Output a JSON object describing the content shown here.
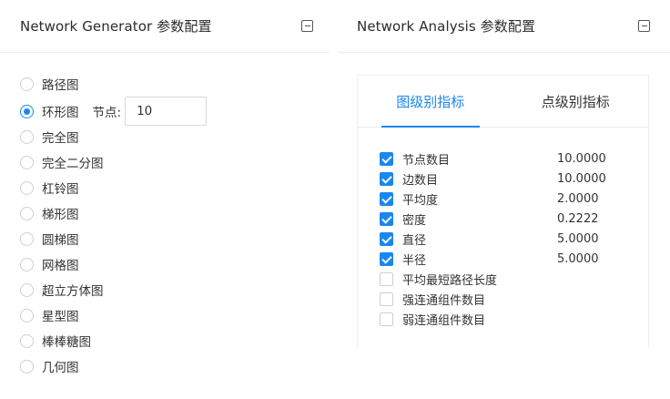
{
  "generator": {
    "title": "Network Generator 参数配置",
    "options": [
      {
        "label": "路径图",
        "checked": false
      },
      {
        "label": "环形图",
        "checked": true
      },
      {
        "label": "完全图",
        "checked": false
      },
      {
        "label": "完全二分图",
        "checked": false
      },
      {
        "label": "杠铃图",
        "checked": false
      },
      {
        "label": "梯形图",
        "checked": false
      },
      {
        "label": "圆梯图",
        "checked": false
      },
      {
        "label": "网格图",
        "checked": false
      },
      {
        "label": "超立方体图",
        "checked": false
      },
      {
        "label": "星型图",
        "checked": false
      },
      {
        "label": "棒棒糖图",
        "checked": false
      },
      {
        "label": "几何图",
        "checked": false
      }
    ],
    "node_label": "节点:",
    "node_value": "10"
  },
  "analysis": {
    "title": "Network Analysis 参数配置",
    "tabs": [
      {
        "label": "图级别指标",
        "active": true
      },
      {
        "label": "点级别指标",
        "active": false
      }
    ],
    "metrics": [
      {
        "name": "节点数目",
        "value": "10.0000",
        "checked": true
      },
      {
        "name": "边数目",
        "value": "10.0000",
        "checked": true
      },
      {
        "name": "平均度",
        "value": "2.0000",
        "checked": true
      },
      {
        "name": "密度",
        "value": "0.2222",
        "checked": true
      },
      {
        "name": "直径",
        "value": "5.0000",
        "checked": true
      },
      {
        "name": "半径",
        "value": "5.0000",
        "checked": true
      },
      {
        "name": "平均最短路径长度",
        "value": "",
        "checked": false
      },
      {
        "name": "强连通组件数目",
        "value": "",
        "checked": false
      },
      {
        "name": "弱连通组件数目",
        "value": "",
        "checked": false
      }
    ]
  },
  "colors": {
    "accent": "#1a86f2"
  }
}
